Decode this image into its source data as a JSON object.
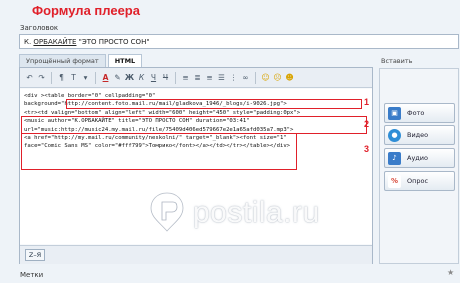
{
  "annotation_title": "Формула плеера",
  "header": {
    "title_label": "Заголовок"
  },
  "title_input": {
    "prefix": "К. ",
    "artist": "ОРБАКАЙТЕ",
    "rest": " \"ЭТО ПРОСТО СОН\""
  },
  "tabs": [
    {
      "label": "Упрощённый формат",
      "active": false
    },
    {
      "label": "HTML",
      "active": true
    }
  ],
  "toolbar": {
    "undo_icon": "undo-icon",
    "redo_icon": "redo-icon",
    "paragraph": "¶",
    "font_size": "T",
    "text_color": "A",
    "bold": "Ж",
    "italic": "К",
    "underline": "Ч",
    "strike": "Ч",
    "emoji_icons": [
      "smile-icon",
      "sad-icon",
      "heart-icon"
    ]
  },
  "code_lines": [
    "<div ><table border=\"0\" cellpadding=\"0\"",
    "background=\"http://content.foto.mail.ru/mail/gladkova_1946/_blogs/i-9026.jpg\">",
    "<tr><td valign=\"bottom\" align=\"left\" width=\"600\" height=\"450\" style=\"padding:0px\">",
    "<music author=\"К.ОРБАКАЙТЕ\" title=\"ЭТО ПРОСТО СОН\" duration=\"03:41\"",
    "url=\"music:http://music24.my.mail.ru/file/75409d406ed579667e2e1a65afd035a7.mp3\">",
    "<a href=\"http://my.mail.ru/community/neskolni/\" target=\"_blank\"><font size=\"1\"",
    "face=\"Comic Sans MS\" color=\"#fff799\">Томрико</font></a></td></tr></table></div>"
  ],
  "markers": [
    "1",
    "2",
    "3"
  ],
  "footer": {
    "za_label": "Z–Я"
  },
  "insert": {
    "label": "Вставить",
    "buttons": [
      {
        "label": "Фото",
        "icon": "photo-icon",
        "color": "#3a7cc9"
      },
      {
        "label": "Видео",
        "icon": "video-icon",
        "color": "#2f8ed6"
      },
      {
        "label": "Аудио",
        "icon": "audio-icon",
        "color": "#3a7cc9"
      },
      {
        "label": "Опрос",
        "icon": "poll-icon",
        "color": "#d94a3a"
      }
    ]
  },
  "tags_label": "Метки",
  "watermark": {
    "text": "postila.ru",
    "color": "#ffffff"
  },
  "colors": {
    "accent_red": "#e0202a",
    "frame_border": "#a9b8c9"
  }
}
